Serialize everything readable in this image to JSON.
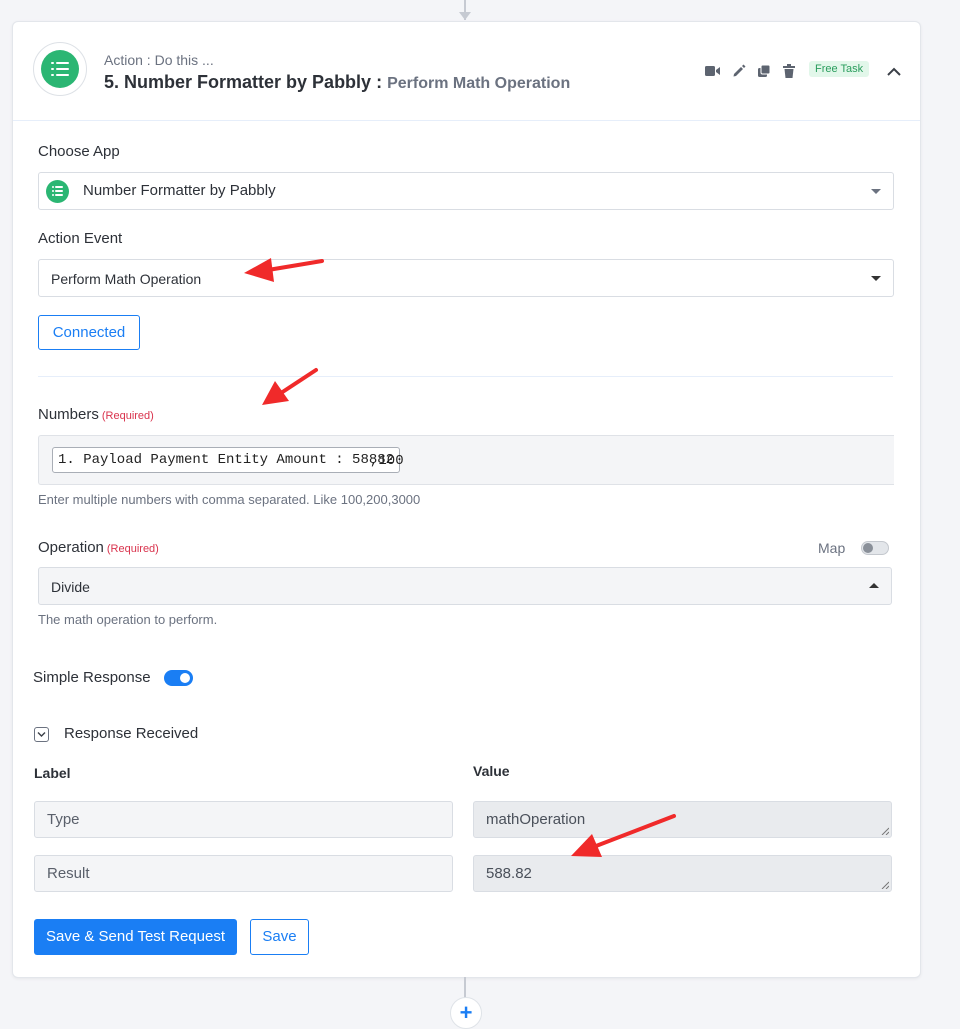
{
  "header": {
    "subtitle": "Action : Do this ...",
    "title": "5. Number Formatter by Pabbly :",
    "event": "Perform Math Operation",
    "badge": "Free Task",
    "icons": [
      "video-icon",
      "pencil-icon",
      "copy-icon",
      "trash-icon",
      "chevron-up-icon"
    ]
  },
  "choose_app": {
    "label": "Choose App",
    "value": "Number Formatter by Pabbly"
  },
  "action_event": {
    "label": "Action Event",
    "value": "Perform Math Operation"
  },
  "connected_label": "Connected",
  "numbers": {
    "label": "Numbers",
    "required": "(Required)",
    "token": "1. Payload Payment Entity Amount : 58882",
    "suffix": ",100",
    "help": "Enter multiple numbers with comma separated. Like 100,200,3000"
  },
  "operation": {
    "label": "Operation",
    "required": "(Required)",
    "map_label": "Map",
    "value": "Divide",
    "help": "The math operation to perform."
  },
  "simple_response": {
    "label": "Simple Response",
    "enabled": true
  },
  "response": {
    "title": "Response Received",
    "label_header": "Label",
    "value_header": "Value",
    "rows": [
      {
        "label": "Type",
        "value": "mathOperation"
      },
      {
        "label": "Result",
        "value": "588.82"
      }
    ]
  },
  "buttons": {
    "test": "Save & Send Test Request",
    "save": "Save"
  },
  "colors": {
    "accent": "#1a7ef4",
    "brand_green": "#2bb673",
    "required": "#d9334d",
    "annotation": "#f02a2a"
  }
}
